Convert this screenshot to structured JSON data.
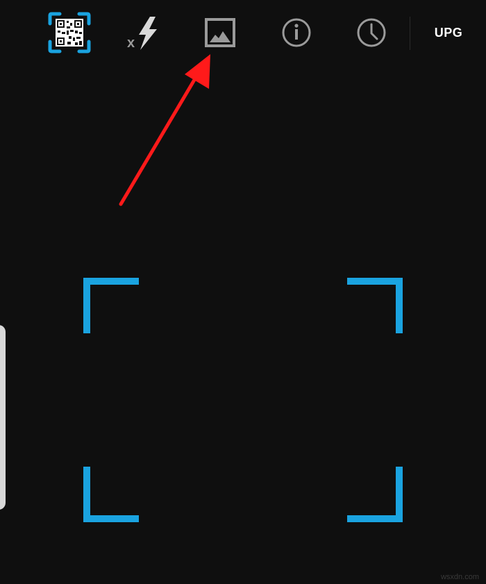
{
  "toolbar": {
    "upgrade_label": "UPG",
    "icons": {
      "scan": "qr-code-scan-icon",
      "flash": "flash-off-icon",
      "gallery": "gallery-image-icon",
      "info": "info-icon",
      "history": "history-clock-icon"
    }
  },
  "watermark": "wsxdn.com",
  "colors": {
    "accent": "#1aa3e0",
    "background": "#0f0f0f",
    "icon_gray": "#9a9a9a",
    "annotation_red": "#ff1a1a"
  }
}
